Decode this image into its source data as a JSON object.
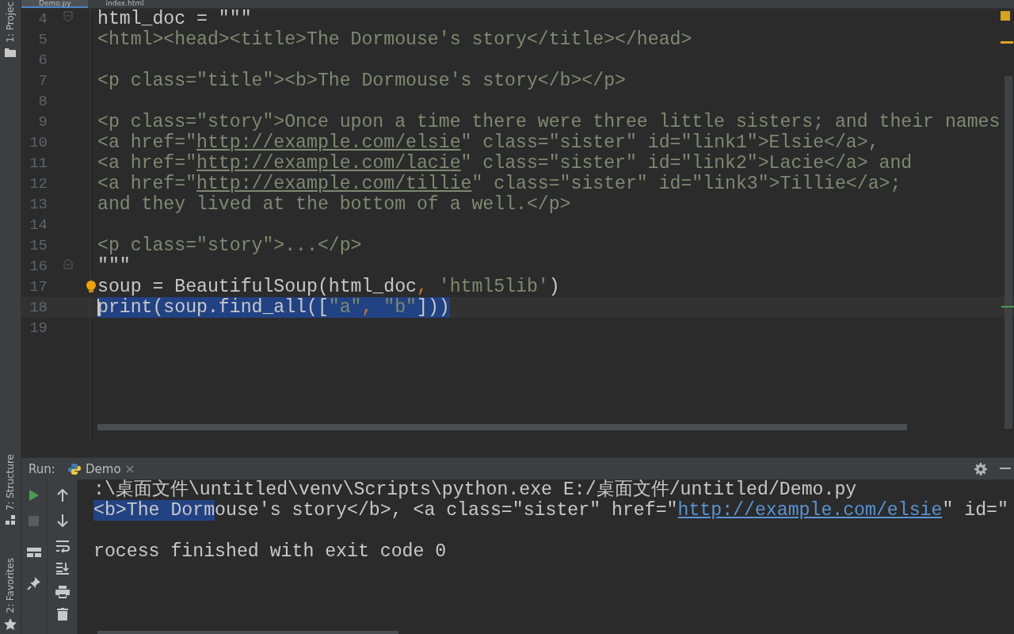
{
  "side_tools": {
    "project": {
      "label": "1: Projec"
    },
    "structure": {
      "label": "7: Structure"
    },
    "favorites": {
      "label": "2: Favorites"
    }
  },
  "editor_tabs": [
    {
      "label": "Demo.py",
      "selected": true
    },
    {
      "label": "index.html",
      "selected": false
    }
  ],
  "code_lines": [
    {
      "number": "4",
      "fold_start": true,
      "segments": [
        {
          "kind": "code",
          "text": "html_doc = \"\"\""
        }
      ]
    },
    {
      "number": "5",
      "segments": [
        {
          "kind": "string",
          "text": "<html><head><title>The Dormouse's story</title></head>"
        }
      ]
    },
    {
      "number": "6"
    },
    {
      "number": "7",
      "segments": [
        {
          "kind": "string",
          "text": "<p class=\"title\"><b>The Dormouse's story</b></p>"
        }
      ]
    },
    {
      "number": "8"
    },
    {
      "number": "9",
      "segments": [
        {
          "kind": "string",
          "text": "<p class=\"story\">Once upon a time there were three little sisters; and their names"
        }
      ]
    },
    {
      "number": "10",
      "segments": [
        {
          "kind": "string",
          "text": "<a href=\""
        },
        {
          "kind": "url",
          "text": "http://example.com/elsie"
        },
        {
          "kind": "string",
          "text": "\" class=\"sister\" id=\"link1\">Elsie</a>,"
        }
      ]
    },
    {
      "number": "11",
      "segments": [
        {
          "kind": "string",
          "text": "<a href=\""
        },
        {
          "kind": "url",
          "text": "http://example.com/lacie"
        },
        {
          "kind": "string",
          "text": "\" class=\"sister\" id=\"link2\">Lacie</a> and"
        }
      ]
    },
    {
      "number": "12",
      "segments": [
        {
          "kind": "string",
          "text": "<a href=\""
        },
        {
          "kind": "url",
          "text": "http://example.com/tillie"
        },
        {
          "kind": "string",
          "text": "\" class=\"sister\" id=\"link3\">Tillie</a>;"
        }
      ]
    },
    {
      "number": "13",
      "segments": [
        {
          "kind": "string",
          "text": "and they lived at the bottom of a well.</p>"
        }
      ]
    },
    {
      "number": "14"
    },
    {
      "number": "15",
      "segments": [
        {
          "kind": "string",
          "text": "<p class=\"story\">...</p>"
        }
      ]
    },
    {
      "number": "16",
      "fold_end": true,
      "segments": [
        {
          "kind": "code",
          "text": "\"\"\""
        }
      ]
    },
    {
      "number": "17",
      "bulb": true,
      "segments": [
        {
          "kind": "code",
          "text": "soup = BeautifulSoup(html_doc"
        },
        {
          "kind": "punct",
          "text": ","
        },
        {
          "kind": "string",
          "text": " 'html5lib'"
        },
        {
          "kind": "code",
          "text": ")"
        }
      ]
    },
    {
      "number": "18",
      "current": true,
      "selected": true,
      "segments": [
        {
          "kind": "code",
          "text": "print(soup.find_all(["
        },
        {
          "kind": "string",
          "text": "\"a\""
        },
        {
          "kind": "punct",
          "text": ","
        },
        {
          "kind": "string",
          "text": " \"b\""
        },
        {
          "kind": "code",
          "text": "]))"
        }
      ]
    },
    {
      "number": "19"
    }
  ],
  "run_panel": {
    "label": "Run:",
    "tab": {
      "label": "Demo"
    }
  },
  "console": {
    "command": ":\\桌面文件\\untitled\\venv\\Scripts\\python.exe E:/桌面文件/untitled/Demo.py",
    "output": [
      {
        "kind": "text",
        "text": "<b>The Dorm",
        "selected": true
      },
      {
        "kind": "text",
        "text": "ouse's story</b>, <a class=\"sister\" href=\"",
        "selected": false
      },
      {
        "kind": "url",
        "text": "http://example.com/elsie",
        "selected": false
      },
      {
        "kind": "text",
        "text": "\" id=\"",
        "selected": false
      }
    ],
    "exit_message": "rocess finished with exit code 0"
  }
}
